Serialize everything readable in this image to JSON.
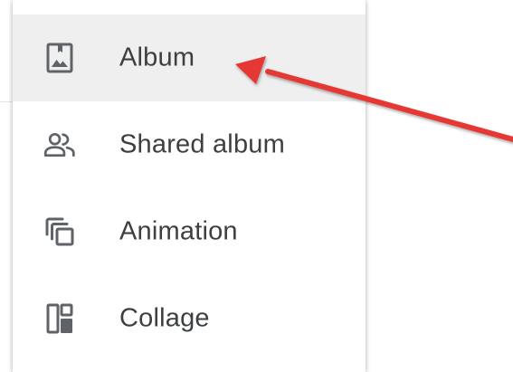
{
  "menu": {
    "items": [
      {
        "label": "Album",
        "icon": "photo-album-icon",
        "active": true
      },
      {
        "label": "Shared album",
        "icon": "people-icon",
        "active": false
      },
      {
        "label": "Animation",
        "icon": "animation-icon",
        "active": false
      },
      {
        "label": "Collage",
        "icon": "collage-icon",
        "active": false
      }
    ]
  },
  "colors": {
    "icon": "#5f6368",
    "label": "#3c4043",
    "active_background": "#efefef",
    "annotation_arrow": "#e53935"
  },
  "annotation": {
    "type": "arrow",
    "points_to": "Album"
  }
}
